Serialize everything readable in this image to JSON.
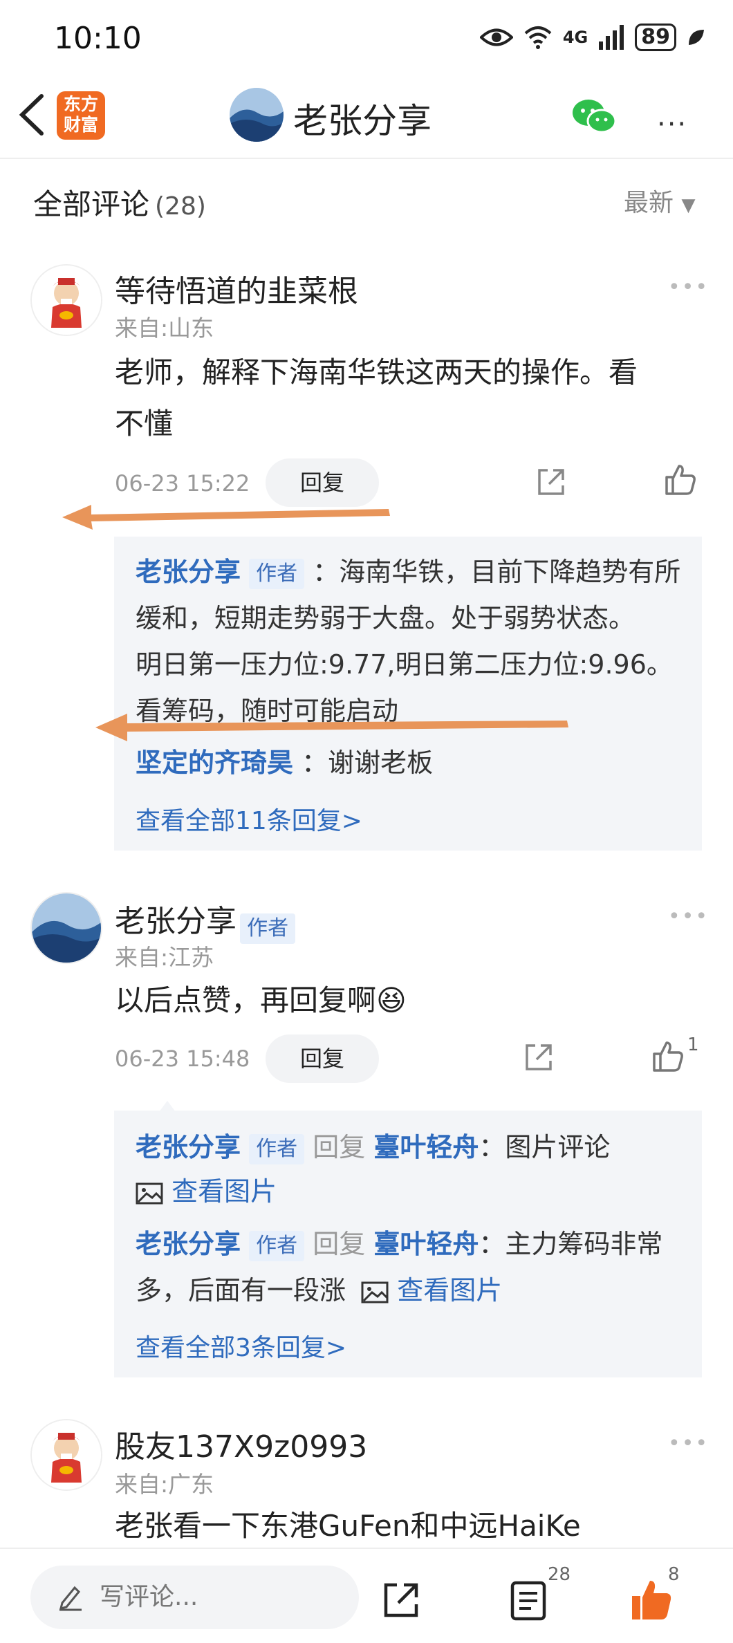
{
  "status": {
    "time": "10:10",
    "network": "4G",
    "signal": "6",
    "battery": "89"
  },
  "nav": {
    "back_label": "<",
    "logo_text_1": "东方",
    "logo_text_2": "财富",
    "title": "老张分享",
    "more": "···",
    "accent": "#f06a22"
  },
  "section": {
    "title": "全部评论",
    "count": "(28)",
    "sort": "最新",
    "sort_icon": "▼"
  },
  "comments": [
    {
      "user": "等待悟道的韭菜根",
      "location": "来自:山东",
      "text_1": "老师，解释下海南华铁这两天的操作。看",
      "text_2": "不懂",
      "time": "06-23 15:22",
      "reply_label": "回复",
      "replies": {
        "r1_user": "老张分享",
        "r1_badge": "作者",
        "r1_text_1": "：海南华铁，目前下降趋势有所",
        "r1_text_2": "缓和，短期走势弱于大盘。处于弱势状态。",
        "r1_text_3": "明日第一压力位:9.77,明日第二压力位:9.96。",
        "r1_text_4": "看筹码，随时可能启动",
        "r2_user": "坚定的齐琦昊",
        "r2_text": "：谢谢老板",
        "view_all": "查看全部11条回复>"
      }
    },
    {
      "user": "老张分享",
      "badge": "作者",
      "location": "来自:江苏",
      "text": "以后点赞，再回复啊",
      "emoji": "😆",
      "time": "06-23 15:48",
      "reply_label": "回复",
      "like_count": "1",
      "replies": {
        "r1_user": "老张分享",
        "r1_badge": "作者",
        "r1_verb": "回复",
        "r1_target": "臺叶轻舟",
        "r1_text": "：图片评论",
        "r1_image": "查看图片",
        "r2_user": "老张分享",
        "r2_badge": "作者",
        "r2_verb": "回复",
        "r2_target": "臺叶轻舟",
        "r2_text_1": "：主力筹码非常",
        "r2_text_2": "多，后面有一段涨",
        "r2_image": "查看图片",
        "view_all": "查看全部3条回复>"
      }
    },
    {
      "user": "股友137X9z0993",
      "location": "来自:广东",
      "text": "老张看一下东港GuFen和中远HaiKe"
    }
  ],
  "bottom": {
    "write_placeholder": "写评论...",
    "comment_count": "28",
    "like_count": "8"
  },
  "colors": {
    "arrow": "#e8955a",
    "link": "#2f6bbd",
    "like": "#f06a22"
  }
}
